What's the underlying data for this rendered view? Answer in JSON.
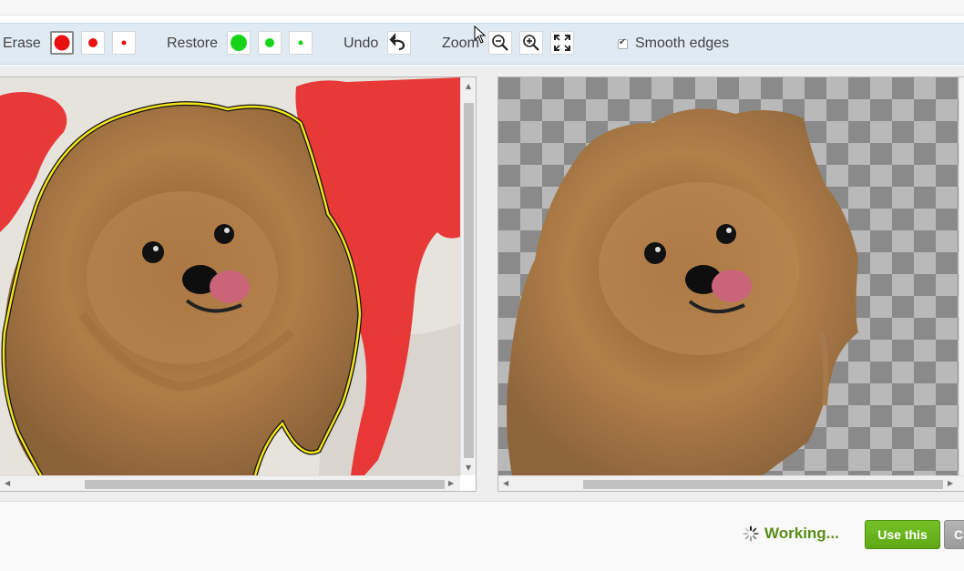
{
  "toolbar": {
    "erase_label": "Erase",
    "restore_label": "Restore",
    "undo_label": "Undo",
    "zoom_label": "Zoom",
    "smooth_edges_label": "Smooth edges",
    "smooth_edges_checked": true,
    "erase_color": "#e81010",
    "restore_color": "#18d418",
    "icons": [
      "undo-icon",
      "zoom-out-icon",
      "zoom-in-icon",
      "fit-screen-icon"
    ]
  },
  "status": {
    "text": "Working...",
    "color": "#5a8d16"
  },
  "buttons": {
    "use_this": "Use this",
    "cancel_partial": "C"
  }
}
